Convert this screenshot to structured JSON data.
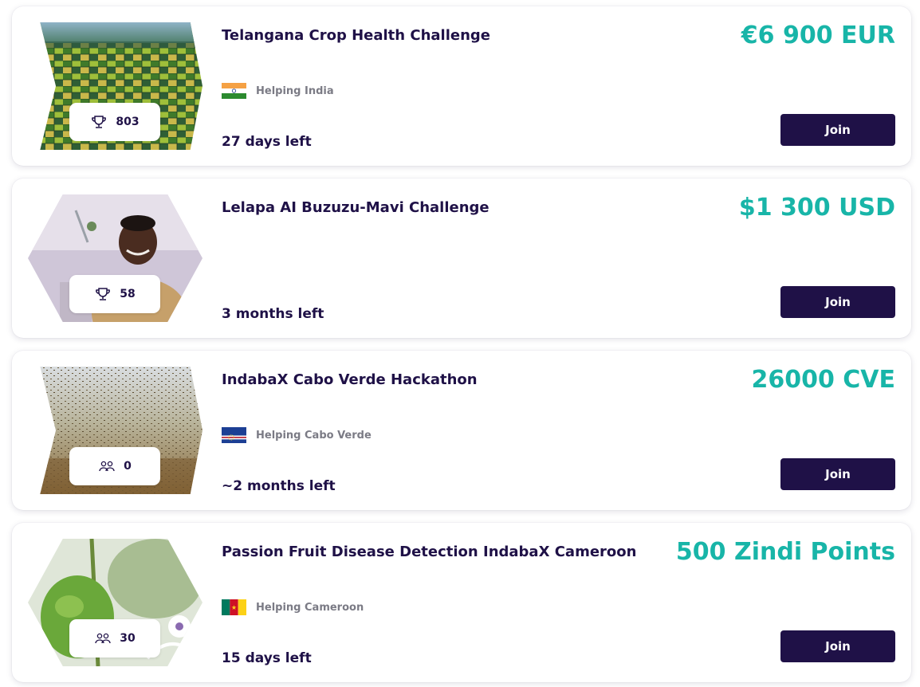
{
  "challenges": [
    {
      "title": "Telangana Crop Health Challenge",
      "prize": "€6 900 EUR",
      "participants": "803",
      "participants_icon": "trophy-icon",
      "helping": "Helping India",
      "flag": "india-flag-icon",
      "time_left": "27 days left",
      "join_label": "Join"
    },
    {
      "title": "Lelapa AI Buzuzu-Mavi Challenge",
      "prize": "$1 300 USD",
      "participants": "58",
      "participants_icon": "trophy-icon",
      "time_left": "3 months left",
      "join_label": "Join"
    },
    {
      "title": "IndabaX Cabo Verde Hackathon",
      "prize": "26000 CVE",
      "participants": "0",
      "participants_icon": "people-icon",
      "helping": "Helping Cabo Verde",
      "flag": "cabo-verde-flag-icon",
      "time_left": "~2 months left",
      "join_label": "Join"
    },
    {
      "title": "Passion Fruit Disease Detection IndabaX Cameroon",
      "prize": "500 Zindi Points",
      "participants": "30",
      "participants_icon": "people-icon",
      "helping": "Helping Cameroon",
      "flag": "cameroon-flag-icon",
      "time_left": "15 days left",
      "join_label": "Join"
    }
  ],
  "colors": {
    "prize": "#18b5a8",
    "title": "#1f1147",
    "join_button": "#1f1147",
    "helping_text": "#7b7b85"
  }
}
